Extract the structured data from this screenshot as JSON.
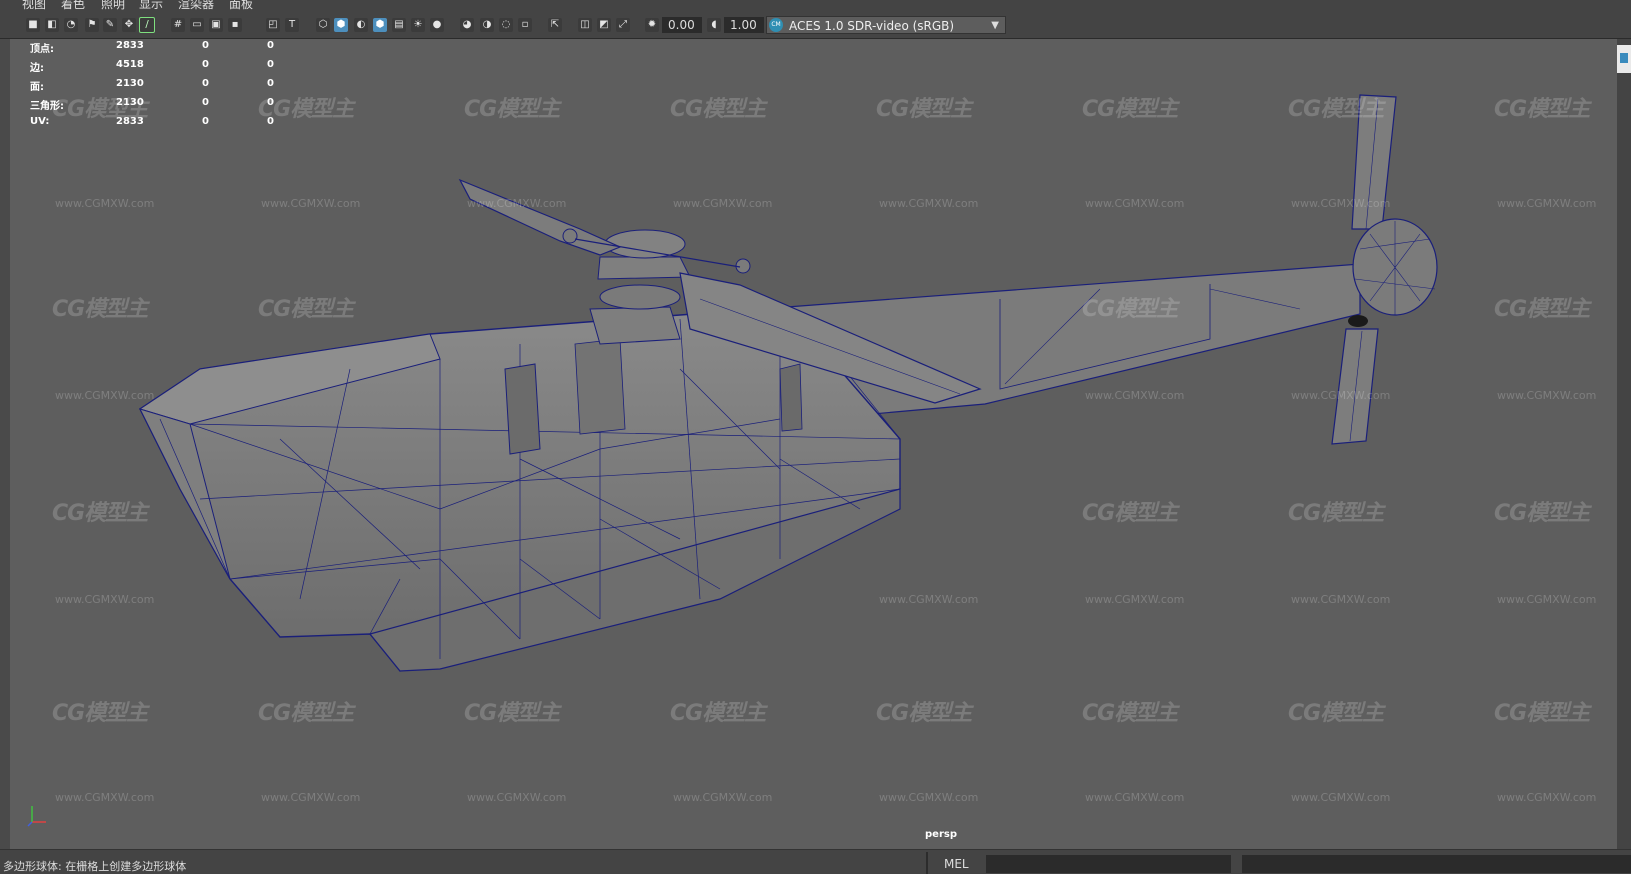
{
  "menu": {
    "items": [
      "视图",
      "着色",
      "照明",
      "显示",
      "渲染器",
      "面板"
    ]
  },
  "toolbar": {
    "exposure": "0.00",
    "gamma": "1.00",
    "color_space": "ACES 1.0 SDR-video (sRGB)"
  },
  "hud": {
    "rows": [
      {
        "label": "顶点:",
        "v1": "2833",
        "v2": "0",
        "v3": "0"
      },
      {
        "label": "边:",
        "v1": "4518",
        "v2": "0",
        "v3": "0"
      },
      {
        "label": "面:",
        "v1": "2130",
        "v2": "0",
        "v3": "0"
      },
      {
        "label": "三角形:",
        "v1": "2130",
        "v2": "0",
        "v3": "0"
      },
      {
        "label": "UV:",
        "v1": "2833",
        "v2": "0",
        "v3": "0"
      }
    ]
  },
  "viewport": {
    "camera": "persp",
    "watermark_logo": "CG模型主",
    "watermark_url": "www.CGMXW.com",
    "mesh_color": "#1a1f7a",
    "surface_color": "#7a7a7a"
  },
  "statusbar": {
    "message": "多边形球体: 在栅格上创建多边形球体",
    "mel_label": "MEL"
  }
}
